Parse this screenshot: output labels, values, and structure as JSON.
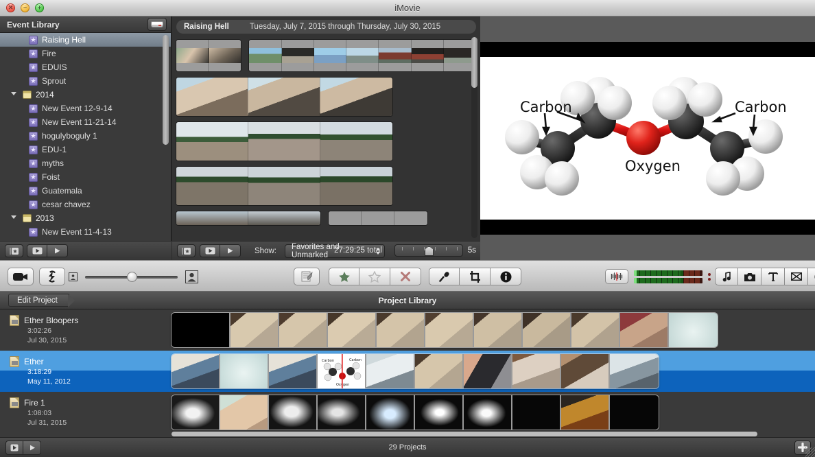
{
  "window": {
    "title": "iMovie"
  },
  "sidebar": {
    "header": "Event Library",
    "eject_icon": "drive-eject-icon",
    "items": [
      {
        "label": "Raising Hell",
        "type": "event",
        "selected": true,
        "indent": 1
      },
      {
        "label": "Fire",
        "type": "event",
        "selected": false,
        "indent": 1
      },
      {
        "label": "EDUIS",
        "type": "event",
        "selected": false,
        "indent": 1
      },
      {
        "label": "Sprout",
        "type": "event",
        "selected": false,
        "indent": 1
      },
      {
        "label": "2014",
        "type": "year",
        "selected": false,
        "indent": 0,
        "expanded": true
      },
      {
        "label": "New Event 12-9-14",
        "type": "event",
        "selected": false,
        "indent": 1
      },
      {
        "label": "New Event 11-21-14",
        "type": "event",
        "selected": false,
        "indent": 1
      },
      {
        "label": "hogulyboguly 1",
        "type": "event",
        "selected": false,
        "indent": 1
      },
      {
        "label": "EDU-1",
        "type": "event",
        "selected": false,
        "indent": 1
      },
      {
        "label": "myths",
        "type": "event",
        "selected": false,
        "indent": 1
      },
      {
        "label": "Foist",
        "type": "event",
        "selected": false,
        "indent": 1
      },
      {
        "label": "Guatemala",
        "type": "event",
        "selected": false,
        "indent": 1
      },
      {
        "label": "cesar chavez",
        "type": "event",
        "selected": false,
        "indent": 1
      },
      {
        "label": "2013",
        "type": "year",
        "selected": false,
        "indent": 0,
        "expanded": true
      },
      {
        "label": "New Event 11-4-13",
        "type": "event",
        "selected": false,
        "indent": 1
      }
    ]
  },
  "event_browser": {
    "event_name": "Raising Hell",
    "date_range": "Tuesday, July 7, 2015 through Thursday, July 30, 2015",
    "toolbar": {
      "keyword_icon": "keyword-star-icon",
      "play_selection_icon": "play-selection-icon",
      "play_icon": "play-icon",
      "show_label": "Show:",
      "show_value": "Favorites and Unmarked",
      "total_label": "27:29:25 total",
      "thumbnail_duration": "5s"
    }
  },
  "main_toolbar": {
    "camera_import_icon": "camera-import-icon",
    "swap_panes_icon": "swap-events-projects-icon",
    "crop_small_icon": "thumbnail-small-icon",
    "crop_large_icon": "thumbnail-large-icon",
    "unmarked_icon": "mark-unmarked-icon",
    "favorite_icon": "favorite-star-filled-icon",
    "unfavorite_icon": "unmark-star-outline-icon",
    "reject_icon": "reject-x-icon",
    "voiceover_icon": "voiceover-microphone-icon",
    "crop_icon": "crop-icon",
    "inspector_icon": "inspector-info-icon",
    "waveform_icon": "audio-waveform-icon",
    "music_icon": "music-and-sound-effects-icon",
    "photos_icon": "photos-icon",
    "titles_icon": "titles-icon",
    "transitions_icon": "transitions-icon",
    "maps_backgrounds_icon": "maps-backgrounds-animatics-icon"
  },
  "project_library": {
    "edit_project_label": "Edit Project",
    "title": "Project Library",
    "projects": [
      {
        "name": "Ether Bloopers",
        "duration": "3:02:26",
        "date": "Jul 30, 2015",
        "selected": false
      },
      {
        "name": "Ether",
        "duration": "3:18:29",
        "date": "May 11, 2012",
        "selected": true
      },
      {
        "name": "Fire 1",
        "duration": "1:08:03",
        "date": "Jul 31, 2015",
        "selected": false
      }
    ]
  },
  "viewer": {
    "image_labels": {
      "left_carbon": "Carbon",
      "right_carbon": "Carbon",
      "oxygen": "Oxygen"
    },
    "colors": {
      "carbon": "#2e2e2e",
      "oxygen": "#d81313",
      "hydrogen": "#f0f0f0"
    }
  },
  "status_bar": {
    "play_full_icon": "play-fullscreen-icon",
    "play_icon": "play-icon",
    "count": "29 Projects",
    "add_icon": "add-plus-icon"
  }
}
